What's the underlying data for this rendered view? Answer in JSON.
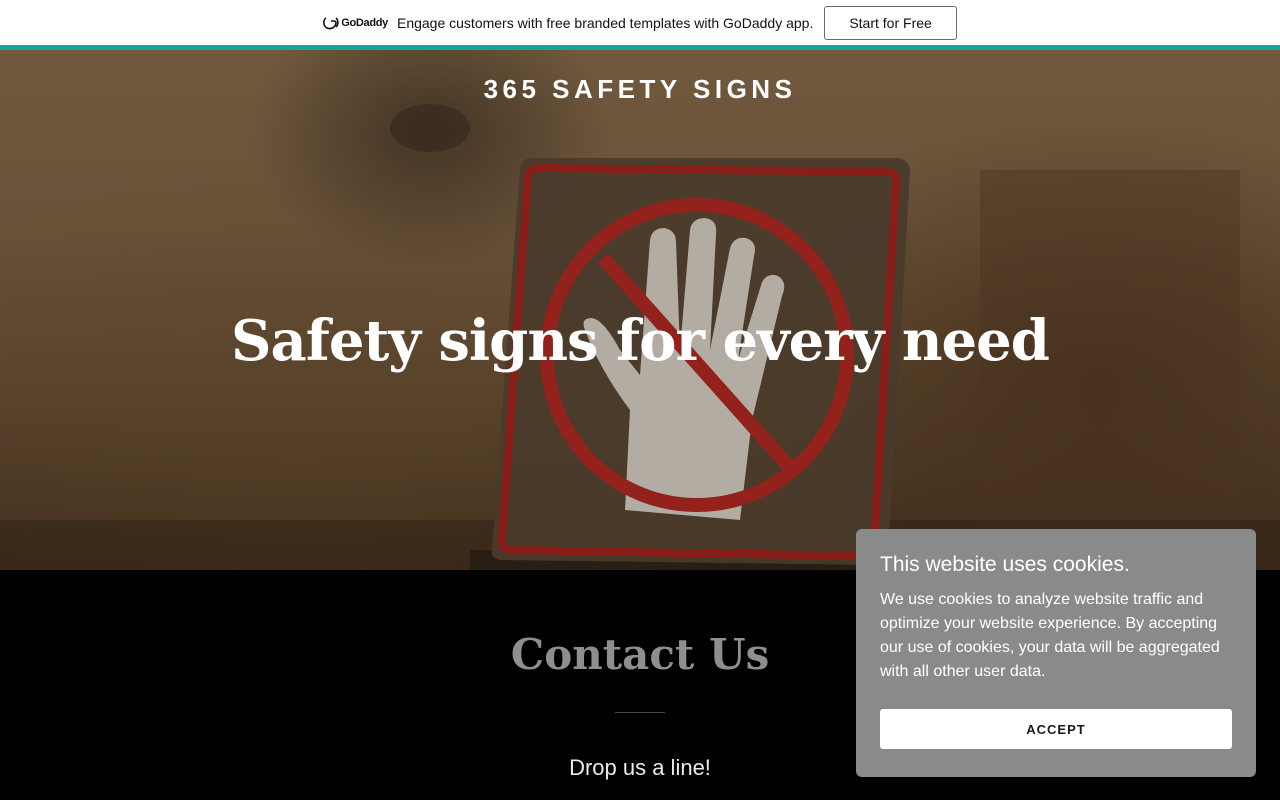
{
  "promo": {
    "logo_text": "GoDaddy",
    "message": "Engage customers with free branded templates with GoDaddy app.",
    "cta_label": "Start for Free",
    "stripe_color": "#1ba29a"
  },
  "hero": {
    "site_title": "365 SAFETY SIGNS",
    "headline": "Safety signs for every need",
    "image_subject": "no-entry hand sign on a table"
  },
  "contact": {
    "title": "Contact Us",
    "subtitle": "Drop us a line!"
  },
  "cookie_banner": {
    "title": "This website uses cookies.",
    "body": "We use cookies to analyze website traffic and optimize your website experience. By accepting our use of cookies, your data will be aggregated with all other user data.",
    "accept_label": "ACCEPT",
    "background": "#8a8a8a"
  }
}
